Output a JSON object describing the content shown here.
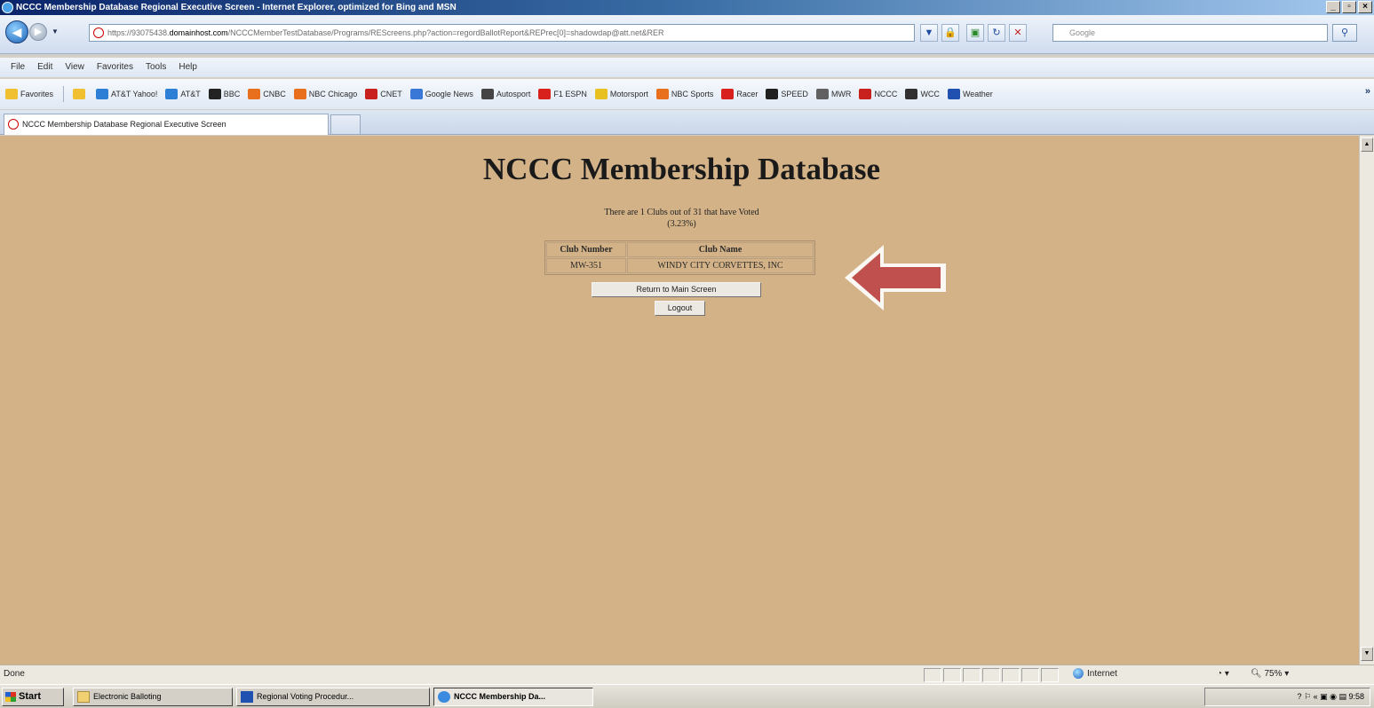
{
  "window": {
    "title": "NCCC Membership Database Regional Executive Screen - Internet Explorer, optimized for Bing and MSN",
    "controls": [
      "_",
      "×"
    ]
  },
  "address": {
    "url_prefix": "https://93075438.",
    "url_host": "domainhost.com",
    "url_rest": "/NCCCMemberTestDatabase/Programs/REScreens.php?action=regordBallotReport&REPrec[0]=shadowdap@att.net&RER",
    "search_placeholder": "Google"
  },
  "menu": [
    "File",
    "Edit",
    "View",
    "Favorites",
    "Tools",
    "Help"
  ],
  "favorites": {
    "label": "Favorites",
    "items": [
      {
        "label": "AT&T Yahoo!",
        "color": "#2d7fd6"
      },
      {
        "label": "AT&T",
        "color": "#2d7fd6"
      },
      {
        "label": "BBC",
        "color": "#222222"
      },
      {
        "label": "CNBC",
        "color": "#e8701c"
      },
      {
        "label": "NBC Chicago",
        "color": "#e8701c"
      },
      {
        "label": "CNET",
        "color": "#c8201c"
      },
      {
        "label": "Google News",
        "color": "#3a78d8"
      },
      {
        "label": "Autosport",
        "color": "#444444"
      },
      {
        "label": "F1 ESPN",
        "color": "#d8201c"
      },
      {
        "label": "Motorsport",
        "color": "#e8c020"
      },
      {
        "label": "NBC Sports",
        "color": "#e8701c"
      },
      {
        "label": "Racer",
        "color": "#d8201c"
      },
      {
        "label": "SPEED",
        "color": "#202020"
      },
      {
        "label": "MWR",
        "color": "#606060"
      },
      {
        "label": "NCCC",
        "color": "#c8201c"
      },
      {
        "label": "WCC",
        "color": "#303030"
      },
      {
        "label": "Weather",
        "color": "#2050b0"
      }
    ]
  },
  "tab": {
    "label": "NCCC Membership Database Regional Executive Screen"
  },
  "page": {
    "title": "NCCC Membership Database",
    "summary_line1": "There are 1 Clubs out of 31 that have Voted",
    "summary_line2": "(3.23%)",
    "table": {
      "headers": [
        "Club Number",
        "Club Name"
      ],
      "rows": [
        [
          "MW-351",
          "WINDY CITY CORVETTES, INC"
        ]
      ]
    },
    "return_button": "Return to Main Screen",
    "logout_button": "Logout",
    "bg_color": "#d3b287",
    "arrow_color": "#c0504d"
  },
  "status": {
    "text": "Done",
    "zone": "Internet",
    "zoom": "75%"
  },
  "taskbar": {
    "start": "Start",
    "tasks": [
      {
        "label": "Electronic Balloting"
      },
      {
        "label": "Regional Voting Procedur..."
      },
      {
        "label": "NCCC Membership Da..."
      }
    ],
    "clock": "9:58"
  }
}
